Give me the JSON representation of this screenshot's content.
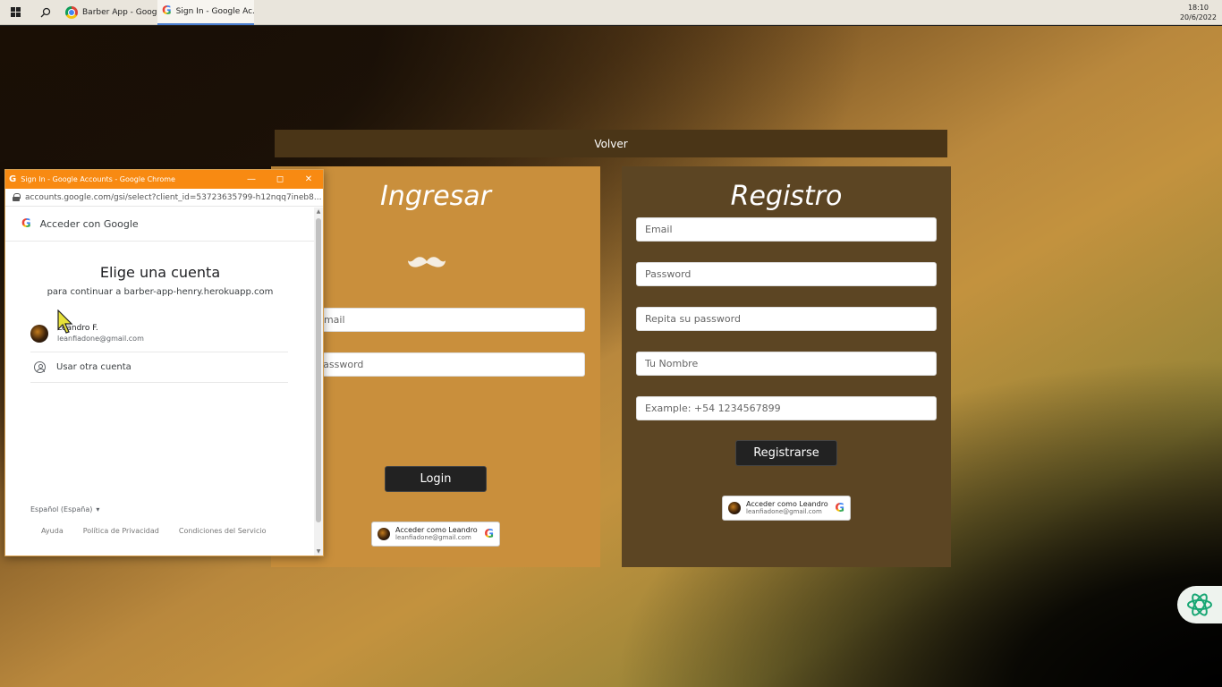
{
  "taskbar": {
    "tabs": [
      {
        "label": "Barber App - Googl..."
      },
      {
        "label": "Sign In - Google Ac..."
      }
    ],
    "time": "18:10",
    "date": "20/6/2022"
  },
  "page": {
    "volver_label": "Volver",
    "login": {
      "title": "Ingresar",
      "email_placeholder": "Email",
      "password_placeholder": "Password",
      "login_button": "Login",
      "google_chip": {
        "name": "Acceder como Leandro",
        "email": "leanfiadone@gmail.com"
      }
    },
    "register": {
      "title": "Registro",
      "email_placeholder": "Email",
      "password_placeholder": "Password",
      "repeat_placeholder": "Repita su password",
      "name_placeholder": "Tu Nombre",
      "phone_placeholder": "Example: +54 1234567899",
      "register_button": "Registrarse",
      "google_chip": {
        "name": "Acceder como Leandro",
        "email": "leanfiadone@gmail.com"
      }
    }
  },
  "popup": {
    "window_title": "Sign In - Google Accounts - Google Chrome",
    "url": "accounts.google.com/gsi/select?client_id=53723635799-h12nqq7ineb8...",
    "header": "Acceder con Google",
    "heading": "Elige una cuenta",
    "subheading": "para continuar a barber-app-henry.herokuapp.com",
    "account": {
      "name": "Leandro F.",
      "email": "leanfiadone@gmail.com"
    },
    "other_account": "Usar otra cuenta",
    "language": "Español (España)",
    "footer": [
      "Ayuda",
      "Política de Privacidad",
      "Condiciones del Servicio"
    ]
  },
  "colors": {
    "login_panel": "#c98f3c",
    "register_panel": "#5c4523",
    "popup_titlebar": "#f88a12"
  }
}
